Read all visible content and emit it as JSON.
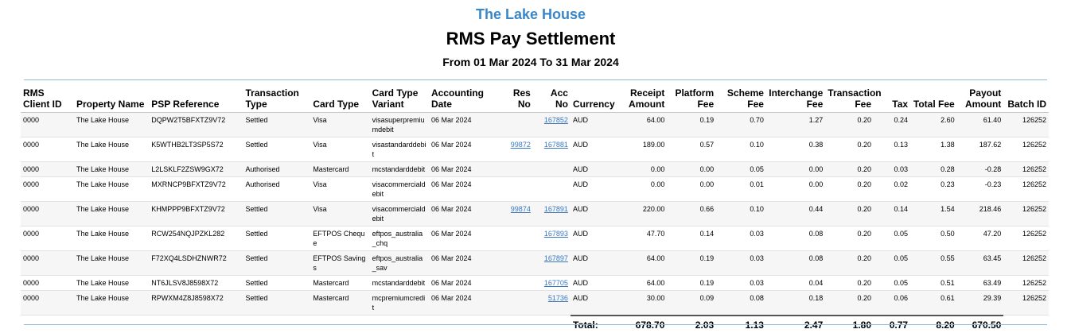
{
  "property_title": "The Lake House",
  "report_title": "RMS Pay Settlement",
  "date_range": "From 01 Mar 2024 To 31 Mar 2024",
  "headers": {
    "client_id": "RMS Client ID",
    "property_name": "Property Name",
    "psp_reference": "PSP Reference",
    "transaction_type": "Transaction Type",
    "card_type": "Card Type",
    "card_type_variant": "Card Type Variant",
    "accounting_date": "Accounting Date",
    "res_no": "Res No",
    "acc_no": "Acc No",
    "currency": "Currency",
    "receipt_amount": "Receipt Amount",
    "platform_fee": "Platform Fee",
    "scheme_fee": "Scheme Fee",
    "interchange_fee": "Interchange Fee",
    "transaction_fee": "Transaction Fee",
    "tax": "Tax",
    "total_fee": "Total Fee",
    "payout_amount": "Payout Amount",
    "batch_id": "Batch ID"
  },
  "rows": [
    {
      "client_id": "0000",
      "property_name": "The Lake House",
      "psp_reference": "DQPW2T5BFXTZ9V72",
      "transaction_type": "Settled",
      "card_type": "Visa",
      "card_type_variant": "visasuperpremiumdebit",
      "accounting_date": "06 Mar 2024",
      "res_no": "",
      "acc_no": "167852",
      "currency": "AUD",
      "receipt_amount": "64.00",
      "platform_fee": "0.19",
      "scheme_fee": "0.70",
      "interchange_fee": "1.27",
      "transaction_fee": "0.20",
      "tax": "0.24",
      "total_fee": "2.60",
      "payout_amount": "61.40",
      "batch_id": "126252"
    },
    {
      "client_id": "0000",
      "property_name": "The Lake House",
      "psp_reference": "K5WTHB2LT3SP5S72",
      "transaction_type": "Settled",
      "card_type": "Visa",
      "card_type_variant": "visastandarddebit",
      "accounting_date": "06 Mar 2024",
      "res_no": "99872",
      "acc_no": "167881",
      "currency": "AUD",
      "receipt_amount": "189.00",
      "platform_fee": "0.57",
      "scheme_fee": "0.10",
      "interchange_fee": "0.38",
      "transaction_fee": "0.20",
      "tax": "0.13",
      "total_fee": "1.38",
      "payout_amount": "187.62",
      "batch_id": "126252"
    },
    {
      "client_id": "0000",
      "property_name": "The Lake House",
      "psp_reference": "L2LSKLF2ZSW9GX72",
      "transaction_type": "Authorised",
      "card_type": "Mastercard",
      "card_type_variant": "mcstandarddebit",
      "accounting_date": "06 Mar 2024",
      "res_no": "",
      "acc_no": "",
      "currency": "AUD",
      "receipt_amount": "0.00",
      "platform_fee": "0.00",
      "scheme_fee": "0.05",
      "interchange_fee": "0.00",
      "transaction_fee": "0.20",
      "tax": "0.03",
      "total_fee": "0.28",
      "payout_amount": "-0.28",
      "batch_id": "126252"
    },
    {
      "client_id": "0000",
      "property_name": "The Lake House",
      "psp_reference": "MXRNCP9BFXTZ9V72",
      "transaction_type": "Authorised",
      "card_type": "Visa",
      "card_type_variant": "visacommercialdebit",
      "accounting_date": "06 Mar 2024",
      "res_no": "",
      "acc_no": "",
      "currency": "AUD",
      "receipt_amount": "0.00",
      "platform_fee": "0.00",
      "scheme_fee": "0.01",
      "interchange_fee": "0.00",
      "transaction_fee": "0.20",
      "tax": "0.02",
      "total_fee": "0.23",
      "payout_amount": "-0.23",
      "batch_id": "126252"
    },
    {
      "client_id": "0000",
      "property_name": "The Lake House",
      "psp_reference": "KHMPPP9BFXTZ9V72",
      "transaction_type": "Settled",
      "card_type": "Visa",
      "card_type_variant": "visacommercialdebit",
      "accounting_date": "06 Mar 2024",
      "res_no": "99874",
      "acc_no": "167891",
      "currency": "AUD",
      "receipt_amount": "220.00",
      "platform_fee": "0.66",
      "scheme_fee": "0.10",
      "interchange_fee": "0.44",
      "transaction_fee": "0.20",
      "tax": "0.14",
      "total_fee": "1.54",
      "payout_amount": "218.46",
      "batch_id": "126252"
    },
    {
      "client_id": "0000",
      "property_name": "The Lake House",
      "psp_reference": "RCW254NQJPZKL282",
      "transaction_type": "Settled",
      "card_type": "EFTPOS Cheque",
      "card_type_variant": "eftpos_australia_chq",
      "accounting_date": "06 Mar 2024",
      "res_no": "",
      "acc_no": "167893",
      "currency": "AUD",
      "receipt_amount": "47.70",
      "platform_fee": "0.14",
      "scheme_fee": "0.03",
      "interchange_fee": "0.08",
      "transaction_fee": "0.20",
      "tax": "0.05",
      "total_fee": "0.50",
      "payout_amount": "47.20",
      "batch_id": "126252"
    },
    {
      "client_id": "0000",
      "property_name": "The Lake House",
      "psp_reference": "F72XQ4LSDHZNWR72",
      "transaction_type": "Settled",
      "card_type": "EFTPOS Savings",
      "card_type_variant": "eftpos_australia_sav",
      "accounting_date": "06 Mar 2024",
      "res_no": "",
      "acc_no": "167897",
      "currency": "AUD",
      "receipt_amount": "64.00",
      "platform_fee": "0.19",
      "scheme_fee": "0.03",
      "interchange_fee": "0.08",
      "transaction_fee": "0.20",
      "tax": "0.05",
      "total_fee": "0.55",
      "payout_amount": "63.45",
      "batch_id": "126252"
    },
    {
      "client_id": "0000",
      "property_name": "The Lake House",
      "psp_reference": "NT6JLSV8J8598X72",
      "transaction_type": "Settled",
      "card_type": "Mastercard",
      "card_type_variant": "mcstandarddebit",
      "accounting_date": "06 Mar 2024",
      "res_no": "",
      "acc_no": "167705",
      "currency": "AUD",
      "receipt_amount": "64.00",
      "platform_fee": "0.19",
      "scheme_fee": "0.03",
      "interchange_fee": "0.04",
      "transaction_fee": "0.20",
      "tax": "0.05",
      "total_fee": "0.51",
      "payout_amount": "63.49",
      "batch_id": "126252"
    },
    {
      "client_id": "0000",
      "property_name": "The Lake House",
      "psp_reference": "RPWXM4Z8J8598X72",
      "transaction_type": "Settled",
      "card_type": "Mastercard",
      "card_type_variant": "mcpremiumcredit",
      "accounting_date": "06 Mar 2024",
      "res_no": "",
      "acc_no": "51736",
      "currency": "AUD",
      "receipt_amount": "30.00",
      "platform_fee": "0.09",
      "scheme_fee": "0.08",
      "interchange_fee": "0.18",
      "transaction_fee": "0.20",
      "tax": "0.06",
      "total_fee": "0.61",
      "payout_amount": "29.39",
      "batch_id": "126252"
    }
  ],
  "totals": {
    "label": "Total:",
    "receipt_amount": "678.70",
    "platform_fee": "2.03",
    "scheme_fee": "1.13",
    "interchange_fee": "2.47",
    "transaction_fee": "1.80",
    "tax": "0.77",
    "total_fee": "8.20",
    "payout_amount": "670.50"
  },
  "colors": {
    "title_blue": "#3a87c8",
    "link_blue": "#3a78c2",
    "rule": "#8bb8dc"
  }
}
